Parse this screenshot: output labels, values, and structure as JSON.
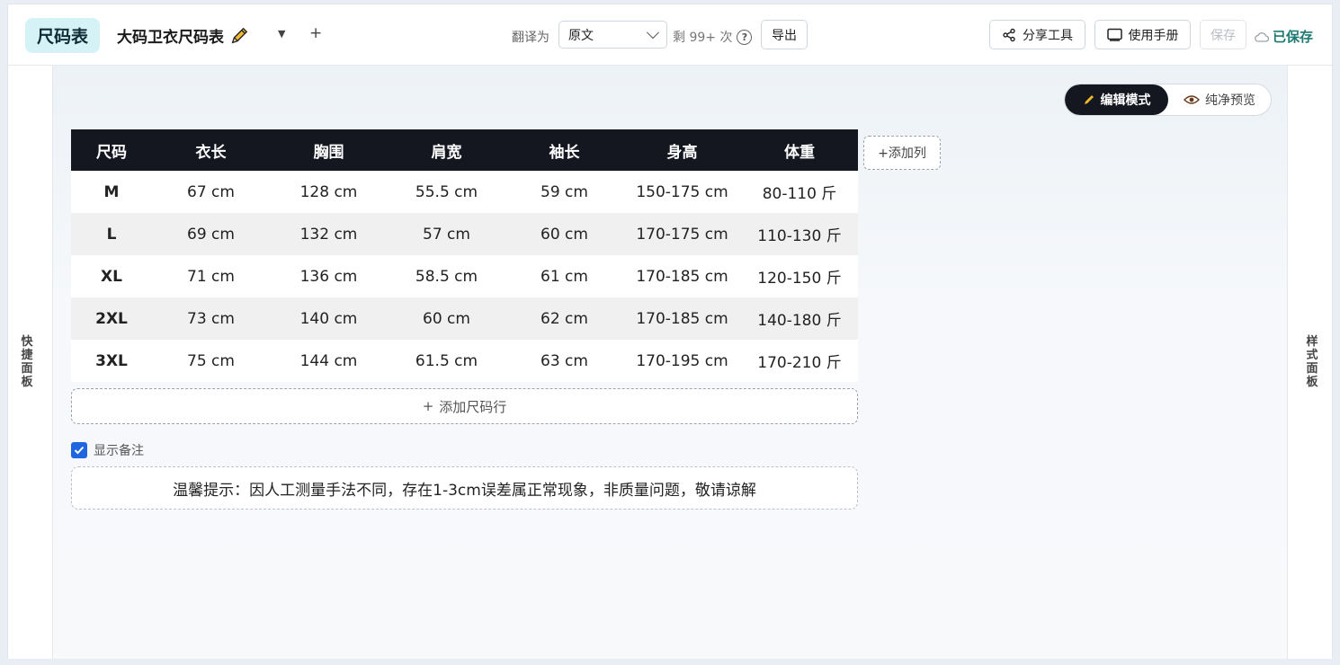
{
  "header": {
    "logo": "尺码表",
    "doc_title": "大码卫衣尺码表",
    "translate_label": "翻译为",
    "translate_value": "原文",
    "remaining_text": "剩 99+ 次",
    "export_label": "导出",
    "share_label": "分享工具",
    "manual_label": "使用手册",
    "save_label": "保存",
    "saved_status": "已保存"
  },
  "side": {
    "left_label": [
      "快",
      "捷",
      "面",
      "板"
    ],
    "right_label": [
      "样",
      "式",
      "面",
      "板"
    ]
  },
  "mode": {
    "edit_label": "编辑模式",
    "preview_label": "纯净预览"
  },
  "table": {
    "headers": [
      "尺码",
      "衣长",
      "胸围",
      "肩宽",
      "袖长",
      "身高",
      "体重"
    ],
    "rows": [
      [
        "M",
        "67 cm",
        "128 cm",
        "55.5 cm",
        "59 cm",
        "150-175 cm",
        "80-110 斤"
      ],
      [
        "L",
        "69 cm",
        "132 cm",
        "57 cm",
        "60 cm",
        "170-175 cm",
        "110-130 斤"
      ],
      [
        "XL",
        "71 cm",
        "136 cm",
        "58.5 cm",
        "61 cm",
        "170-185 cm",
        "120-150 斤"
      ],
      [
        "2XL",
        "73 cm",
        "140 cm",
        "60 cm",
        "62 cm",
        "170-185 cm",
        "140-180 斤"
      ],
      [
        "3XL",
        "75 cm",
        "144 cm",
        "61.5 cm",
        "63 cm",
        "170-195 cm",
        "170-210 斤"
      ]
    ],
    "add_column_label": "+添加列",
    "add_row_label": "添加尺码行"
  },
  "notes": {
    "show_notes_label": "显示备注",
    "show_notes_checked": true,
    "note_text": "温馨提示：因人工测量手法不同，存在1-3cm误差属正常现象，非质量问题，敬请谅解"
  },
  "colors": {
    "accent_dark": "#141720",
    "logo_bg": "#d5f3f6",
    "saved_green": "#1f7a73",
    "checkbox_blue": "#1f66e0"
  }
}
